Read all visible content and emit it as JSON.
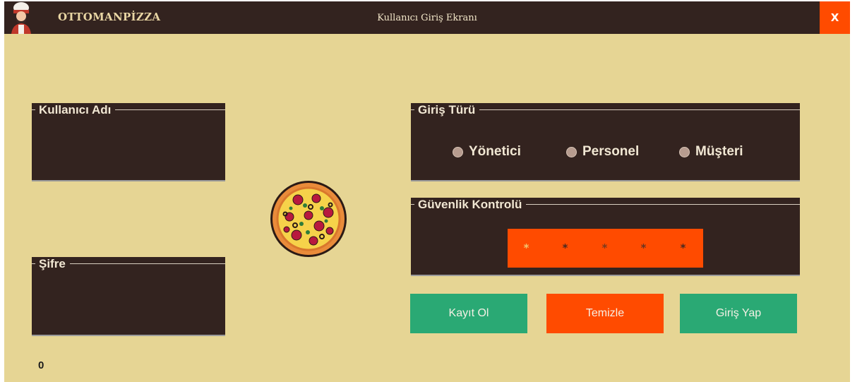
{
  "titlebar": {
    "app_name": "OTTOMANPİZZA",
    "window_title": "Kullanıcı Giriş Ekranı",
    "close_label": "X",
    "avatar_icon": "chef-avatar-icon"
  },
  "login": {
    "username_group": "Kullanıcı Adı",
    "username_value": "",
    "password_group": "Şifre",
    "password_value": ""
  },
  "login_type": {
    "group_label": "Giriş Türü",
    "options": [
      "Yönetici",
      "Personel",
      "Müşteri"
    ],
    "selected": null
  },
  "security": {
    "group_label": "Güvenlik Kontrolü",
    "captcha_chars": [
      "*",
      "*",
      "*",
      "*",
      "*"
    ]
  },
  "buttons": {
    "register": "Kayıt Ol",
    "clear": "Temizle",
    "login": "Giriş Yap"
  },
  "logo_icon": "pizza-icon",
  "status": {
    "counter": "0"
  },
  "colors": {
    "background": "#e6d594",
    "panel": "#33231f",
    "accent_orange": "#ff4b00",
    "accent_green": "#2aa974"
  }
}
